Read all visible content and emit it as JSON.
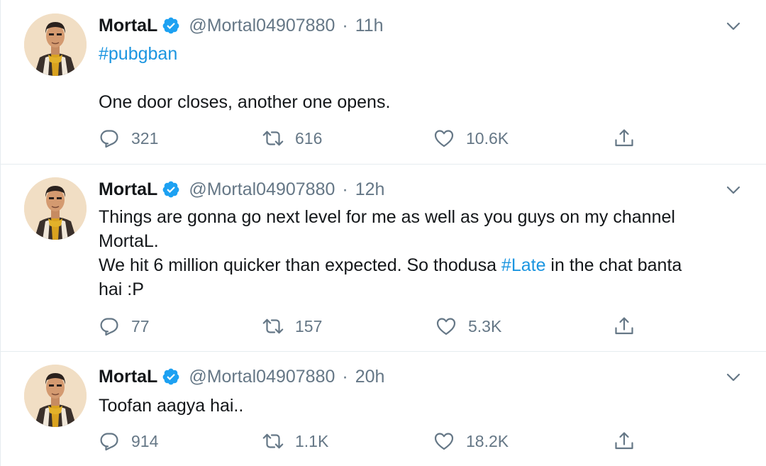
{
  "tweets": [
    {
      "name": "MortaL",
      "handle": "@Mortal04907880",
      "time": "11h",
      "hashtag": "#pubgban",
      "text": "One door closes, another one opens.",
      "replies": "321",
      "retweets": "616",
      "likes": "10.6K"
    },
    {
      "name": "MortaL",
      "handle": "@Mortal04907880",
      "time": "12h",
      "line1": "Things are gonna go next level for me as well as you guys on my channel",
      "line2": "MortaL.",
      "line3_before": "We hit 6 million quicker than expected. So thodusa ",
      "line3_tag": "#Late",
      "line3_after": " in the chat banta",
      "line4": "hai :P",
      "replies": "77",
      "retweets": "157",
      "likes": "5.3K"
    },
    {
      "name": "MortaL",
      "handle": "@Mortal04907880",
      "time": "20h",
      "text": "Toofan aagya hai..",
      "replies": "914",
      "retweets": "1.1K",
      "likes": "18.2K"
    }
  ],
  "separator": "·",
  "colors": {
    "accent": "#1b95e0",
    "muted": "#657786",
    "text": "#14171a",
    "border": "#e6ecf0"
  },
  "icons": [
    "verified-badge-icon",
    "chevron-down-icon",
    "reply-icon",
    "retweet-icon",
    "like-icon",
    "share-icon"
  ]
}
